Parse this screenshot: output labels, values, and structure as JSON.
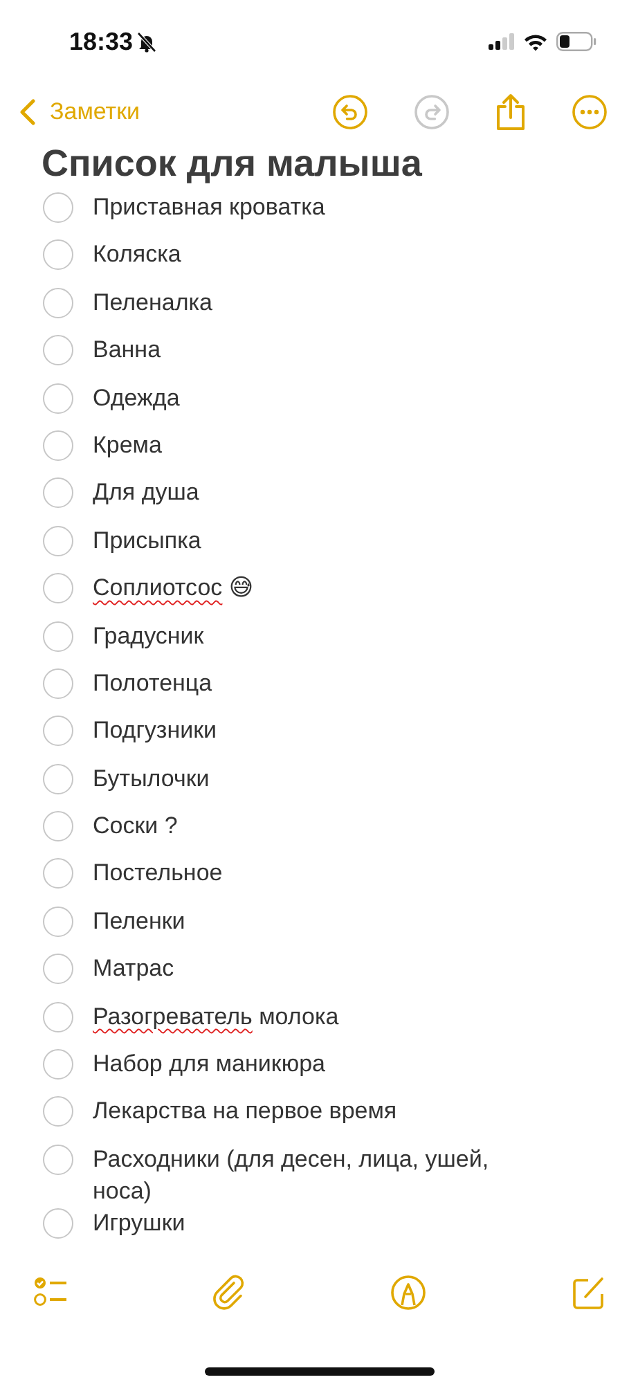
{
  "status_bar": {
    "time": "18:33",
    "silent": true
  },
  "nav": {
    "back_label": "Заметки",
    "undo": {
      "disabled": false
    },
    "redo": {
      "disabled": true
    }
  },
  "title": "Список для малыша",
  "checklist": [
    {
      "checked": false,
      "parts": [
        {
          "text": "Приставная кроватка",
          "misspelled": false
        }
      ]
    },
    {
      "checked": false,
      "parts": [
        {
          "text": "Коляска",
          "misspelled": false
        }
      ]
    },
    {
      "checked": false,
      "parts": [
        {
          "text": "Пеленалка",
          "misspelled": false
        }
      ]
    },
    {
      "checked": false,
      "parts": [
        {
          "text": "Ванна",
          "misspelled": false
        }
      ]
    },
    {
      "checked": false,
      "parts": [
        {
          "text": "Одежда",
          "misspelled": false
        }
      ]
    },
    {
      "checked": false,
      "parts": [
        {
          "text": "Крема",
          "misspelled": false
        }
      ]
    },
    {
      "checked": false,
      "parts": [
        {
          "text": "Для душа",
          "misspelled": false
        }
      ]
    },
    {
      "checked": false,
      "parts": [
        {
          "text": "Присыпка",
          "misspelled": false
        }
      ]
    },
    {
      "checked": false,
      "parts": [
        {
          "text": "Соплиотсос",
          "misspelled": true
        },
        {
          "text": " 😅",
          "misspelled": false
        }
      ]
    },
    {
      "checked": false,
      "parts": [
        {
          "text": "Градусник",
          "misspelled": false
        }
      ]
    },
    {
      "checked": false,
      "parts": [
        {
          "text": "Полотенца",
          "misspelled": false
        }
      ]
    },
    {
      "checked": false,
      "parts": [
        {
          "text": "Подгузники",
          "misspelled": false
        }
      ]
    },
    {
      "checked": false,
      "parts": [
        {
          "text": "Бутылочки",
          "misspelled": false
        }
      ]
    },
    {
      "checked": false,
      "parts": [
        {
          "text": "Соски ?",
          "misspelled": false
        }
      ]
    },
    {
      "checked": false,
      "parts": [
        {
          "text": "Постельное",
          "misspelled": false
        }
      ]
    },
    {
      "checked": false,
      "parts": [
        {
          "text": "Пеленки",
          "misspelled": false
        }
      ]
    },
    {
      "checked": false,
      "parts": [
        {
          "text": "Матрас",
          "misspelled": false
        }
      ]
    },
    {
      "checked": false,
      "parts": [
        {
          "text": "Разогреватель",
          "misspelled": true
        },
        {
          "text": " молока",
          "misspelled": false
        }
      ]
    },
    {
      "checked": false,
      "parts": [
        {
          "text": "Набор для маникюра",
          "misspelled": false
        }
      ]
    },
    {
      "checked": false,
      "parts": [
        {
          "text": "Лекарства на первое время",
          "misspelled": false
        }
      ]
    },
    {
      "checked": false,
      "parts": [
        {
          "text": "Расходники (для десен, лица, ушей, носа)",
          "misspelled": false
        }
      ]
    },
    {
      "checked": false,
      "parts": [
        {
          "text": "Игрушки",
          "misspelled": false
        }
      ]
    }
  ]
}
